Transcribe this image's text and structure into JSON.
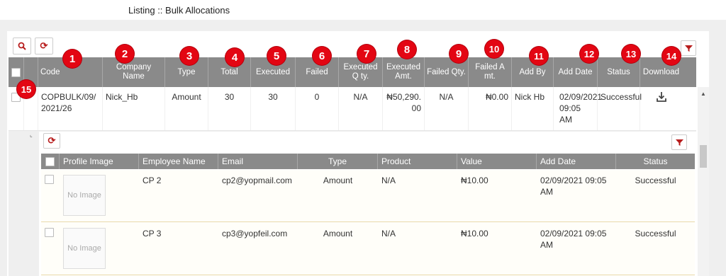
{
  "page": {
    "title": "Listing :: Bulk Allocations"
  },
  "toolbar": {
    "search_icon": "search-icon",
    "refresh_icon": "refresh-icon",
    "filter_icon": "filter-icon"
  },
  "columns": {
    "code": "Code",
    "company_name": "Company Name",
    "type": "Type",
    "total": "Total",
    "executed": "Executed",
    "failed": "Failed",
    "executed_qty": "Executed Q ty.",
    "executed_amt": "Executed Amt.",
    "failed_qty": "Failed Qty.",
    "failed_amt": "Failed A mt.",
    "add_by": "Add By",
    "add_date": "Add Date",
    "status": "Status",
    "download": "Download"
  },
  "badges": [
    "1",
    "2",
    "3",
    "4",
    "5",
    "6",
    "7",
    "8",
    "9",
    "10",
    "11",
    "12",
    "13",
    "14",
    "15"
  ],
  "row": {
    "code": "COPBULK/09/2021/26",
    "company_name": "Nick_Hb",
    "type": "Amount",
    "total": "30",
    "executed": "30",
    "failed": "0",
    "executed_qty": "N/A",
    "executed_amt": "₦50,290.00",
    "failed_qty": "N/A",
    "failed_amt": "₦0.00",
    "add_by": "Nick Hb",
    "add_date": "02/09/2021 09:05 AM",
    "status": "Successful"
  },
  "detail": {
    "columns": {
      "profile_image": "Profile Image",
      "employee_name": "Employee Name",
      "email": "Email",
      "type": "Type",
      "product": "Product",
      "value": "Value",
      "add_date": "Add Date",
      "status": "Status"
    },
    "no_image": "No Image",
    "rows": [
      {
        "employee_name": "CP 2",
        "email": "cp2@yopmail.com",
        "type": "Amount",
        "product": "N/A",
        "value": "₦10.00",
        "add_date": "02/09/2021 09:05 AM",
        "status": "Successful"
      },
      {
        "employee_name": "CP 3",
        "email": "cp3@yopfeil.com",
        "type": "Amount",
        "product": "N/A",
        "value": "₦10.00",
        "add_date": "02/09/2021 09:05 AM",
        "status": "Successful"
      }
    ]
  },
  "colors": {
    "accent": "#8b1a1a",
    "header_bg": "#8a8a8a",
    "badge": "#e30613"
  }
}
